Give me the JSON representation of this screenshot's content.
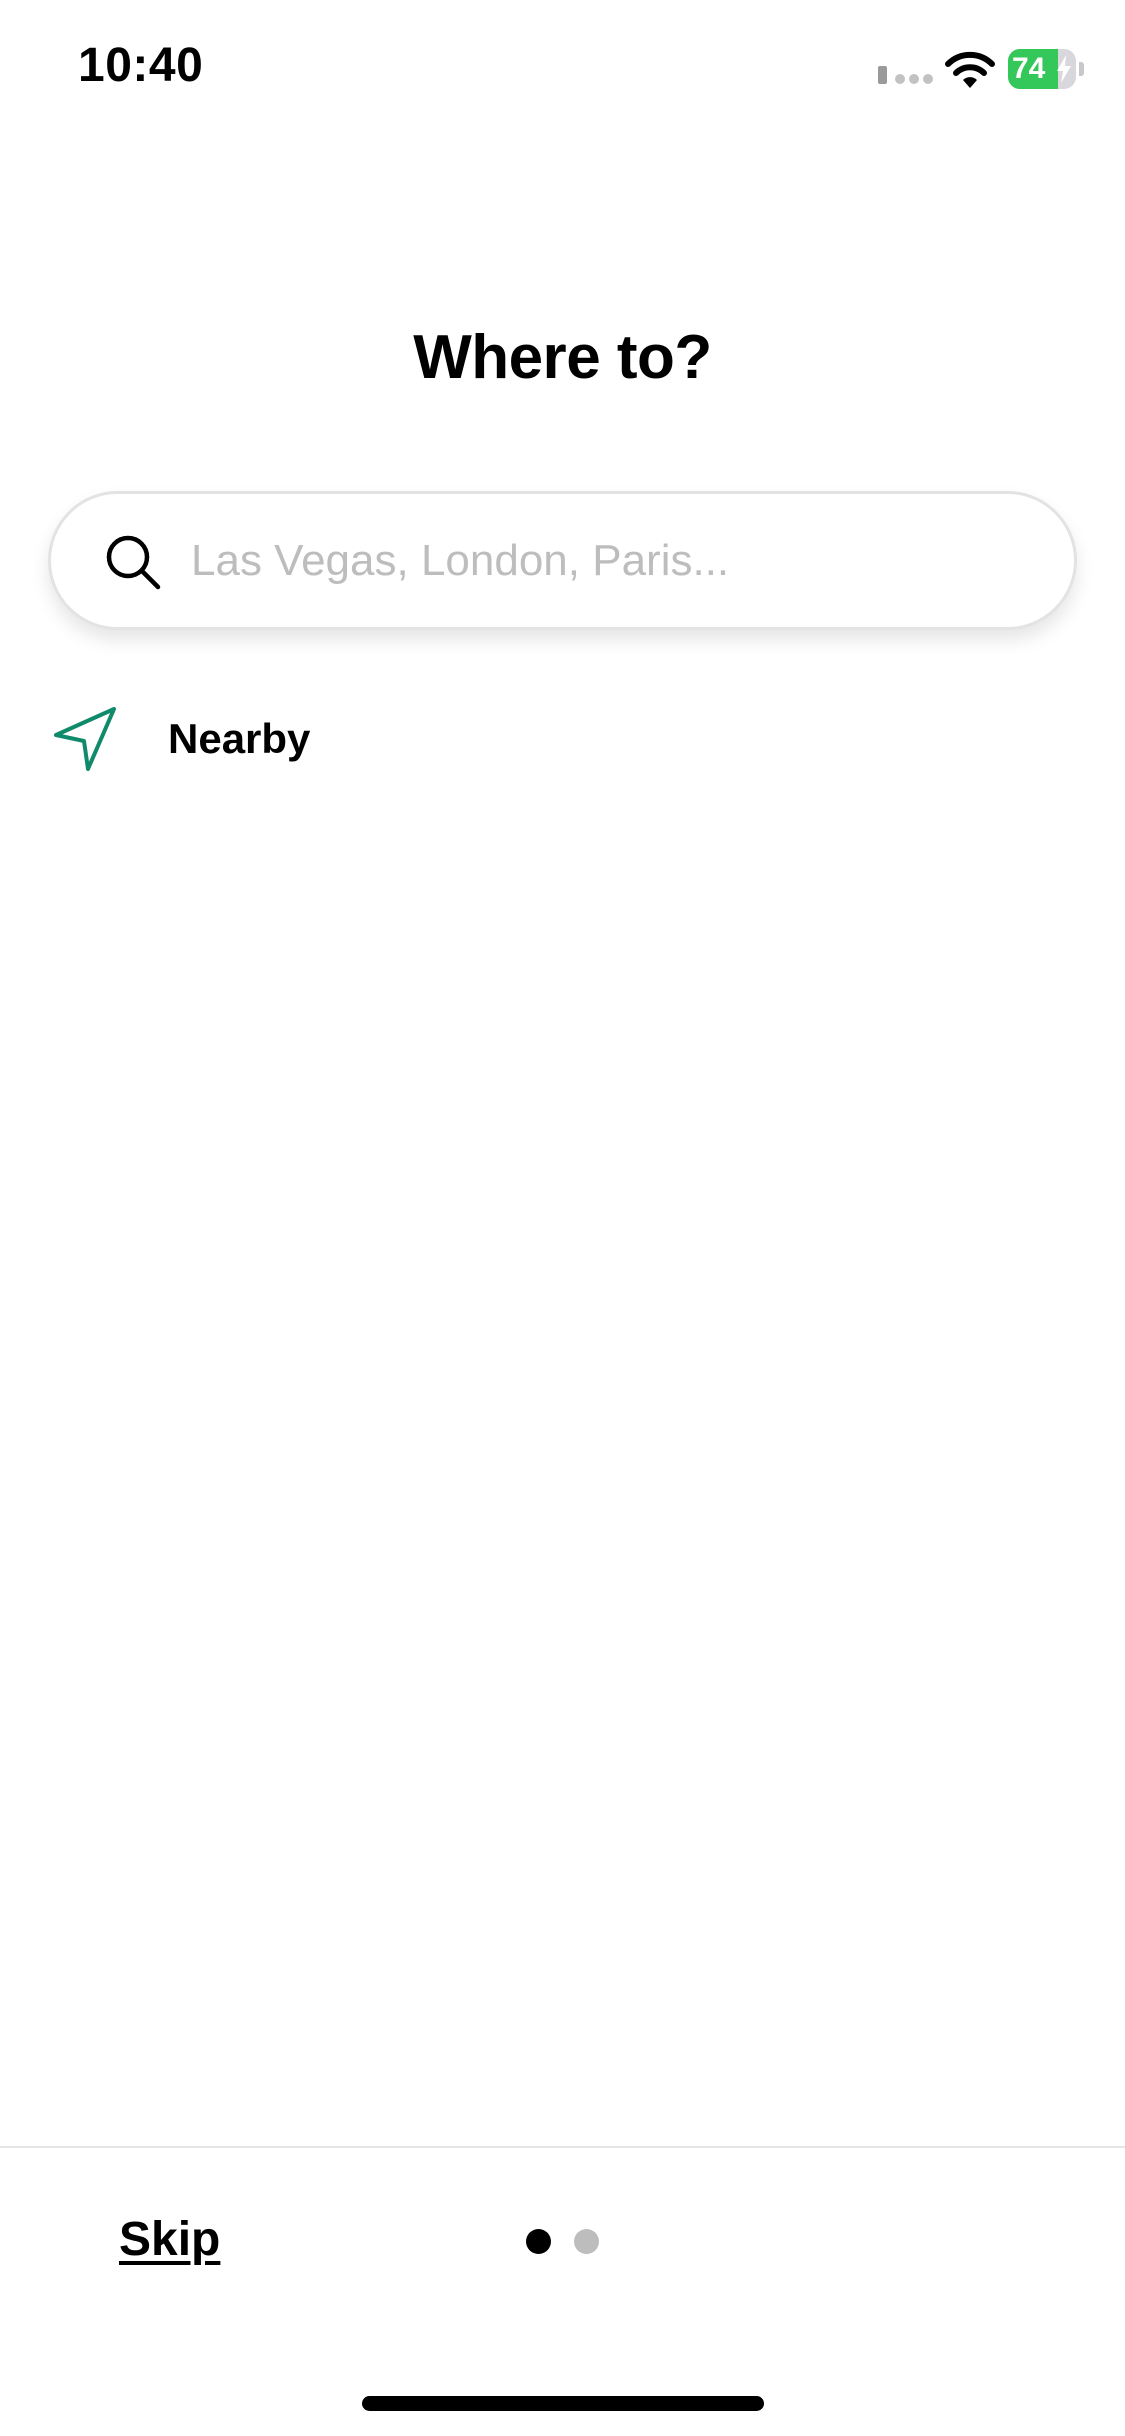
{
  "status_bar": {
    "time": "10:40",
    "battery_level": "74",
    "battery_fraction": 0.74,
    "icons": [
      "signal-icon",
      "wifi-icon",
      "battery-icon",
      "charging-bolt-icon"
    ]
  },
  "header": {
    "title": "Where to?"
  },
  "search": {
    "placeholder": "Las Vegas, London, Paris...",
    "value": "",
    "icon": "search-icon"
  },
  "suggestions": [
    {
      "label": "Nearby",
      "icon": "location-arrow-icon",
      "icon_color": "#0f8a6a"
    }
  ],
  "footer": {
    "skip_label": "Skip",
    "pager": {
      "total": 2,
      "active": 1
    }
  },
  "colors": {
    "accent": "#0f8a6a",
    "battery_green": "#34c759",
    "placeholder": "#bdbdbd",
    "dot_inactive": "#bdbdbd"
  }
}
